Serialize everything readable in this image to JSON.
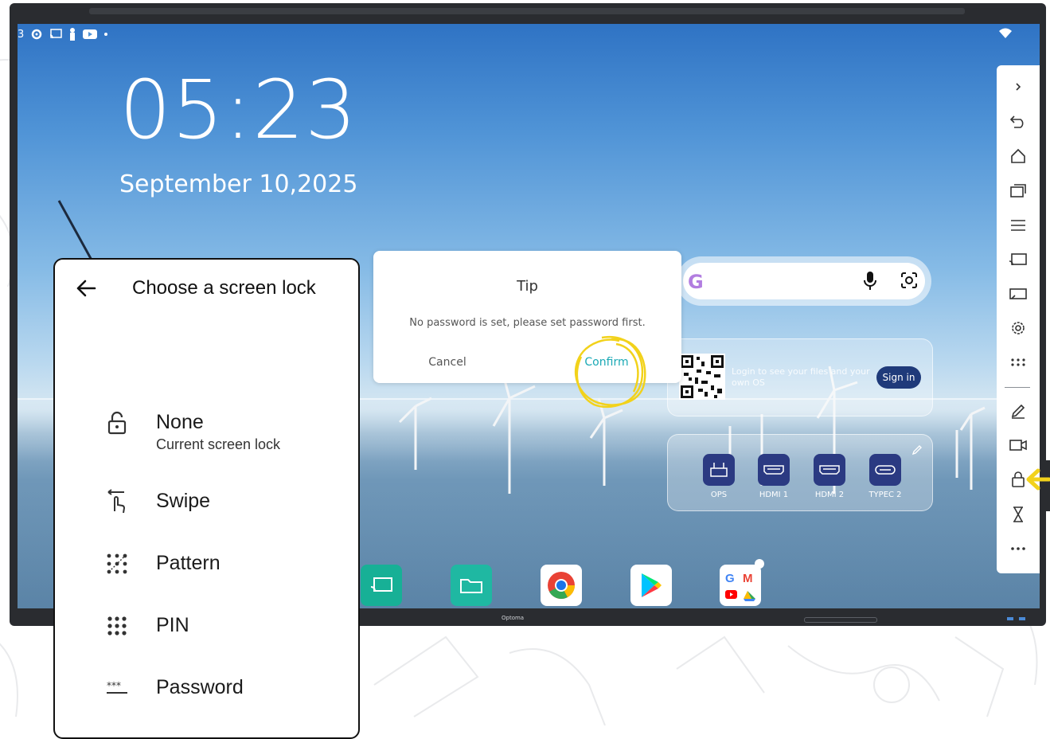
{
  "lockscreen": {
    "time": "05:23",
    "date": "September 10,2025"
  },
  "status_bar": {
    "left_text": "3",
    "icons": [
      "gear-icon",
      "cast-icon",
      "person-icon",
      "youtube-icon",
      "dot-icon"
    ]
  },
  "tip_dialog": {
    "title": "Tip",
    "message": "No password is set, please set password first.",
    "cancel_label": "Cancel",
    "confirm_label": "Confirm"
  },
  "screen_lock": {
    "title": "Choose a screen lock",
    "options": [
      {
        "label": "None",
        "sub": "Current screen lock",
        "icon": "open-lock-icon"
      },
      {
        "label": "Swipe",
        "icon": "swipe-icon"
      },
      {
        "label": "Pattern",
        "icon": "pattern-icon"
      },
      {
        "label": "PIN",
        "icon": "pin-icon"
      },
      {
        "label": "Password",
        "icon": "password-icon"
      }
    ]
  },
  "search_widget": {
    "logo": "G"
  },
  "login_widget": {
    "text": "Login to see your files and your own OS",
    "signin_label": "Sign in"
  },
  "sources": [
    {
      "label": "OPS"
    },
    {
      "label": "HDMI 1"
    },
    {
      "label": "HDMI 2"
    },
    {
      "label": "TYPEC 2"
    }
  ],
  "bezel": {
    "brand": "Optoma"
  },
  "colors": {
    "accent": "#1aa9b5",
    "annotation": "#f2d21b",
    "source_icon_bg": "#2b3a82",
    "signin_bg": "#1f3a7a"
  }
}
